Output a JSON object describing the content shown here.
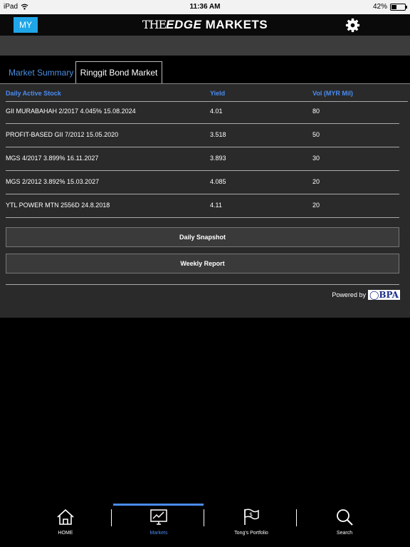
{
  "status_bar": {
    "carrier": "iPad",
    "time": "11:36 AM",
    "battery": "42%",
    "battery_level": 0.42
  },
  "header": {
    "region_button": "MY",
    "logo": {
      "part1": "THE",
      "part2": "EDGE",
      "part3": " MARKETS"
    }
  },
  "tabs": {
    "market_summary": "Market Summary",
    "ringgit_bond_market": "Ringgit Bond Market"
  },
  "table": {
    "headers": {
      "stock": "Daily Active Stock",
      "yield": "Yield",
      "vol": "Vol (MYR Mil)"
    },
    "rows": [
      {
        "stock": "GII MURABAHAH 2/2017 4.045% 15.08.2024",
        "yield": "4.01",
        "vol": "80"
      },
      {
        "stock": "PROFIT-BASED GII 7/2012 15.05.2020",
        "yield": "3.518",
        "vol": "50"
      },
      {
        "stock": "MGS 4/2017 3.899% 16.11.2027",
        "yield": "3.893",
        "vol": "30"
      },
      {
        "stock": "MGS 2/2012 3.892% 15.03.2027",
        "yield": "4.085",
        "vol": "20"
      },
      {
        "stock": "YTL POWER MTN 2556D 24.8.2018",
        "yield": "4.11",
        "vol": "20"
      }
    ]
  },
  "buttons": {
    "daily": "Daily Snapshot",
    "weekly": "Weekly Report"
  },
  "powered_by": {
    "label": "Powered by",
    "brand": "BPA"
  },
  "tabbar": {
    "home": "HOME",
    "markets": "Markets",
    "portfolio": "Tong's Portfolio",
    "search": "Search"
  },
  "colors": {
    "accent": "#4a8cf0",
    "region_button": "#1fa6e8",
    "panel": "#2a2a2a"
  },
  "icons": [
    "wifi-icon",
    "battery-icon",
    "gear-icon",
    "home-icon",
    "markets-chart-icon",
    "portfolio-flag-icon",
    "search-icon"
  ]
}
